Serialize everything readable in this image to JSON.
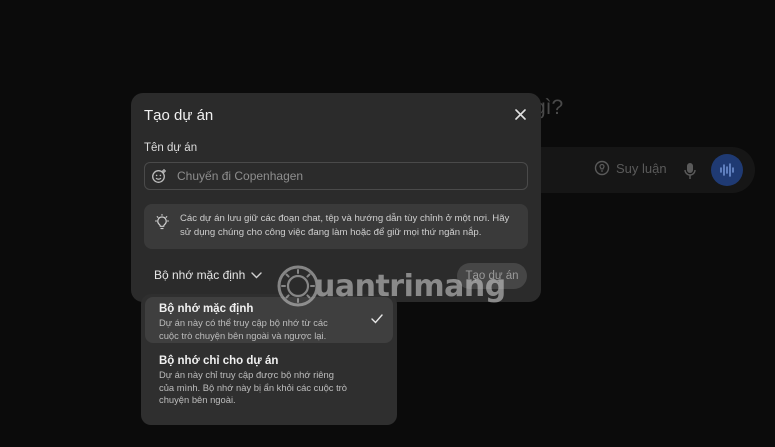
{
  "background": {
    "heading_fragment": "gì?",
    "reason_label": "Suy luận",
    "reason_icon": "bulb-circle-icon",
    "mic_icon": "mic-icon",
    "voice_icon": "waveform-icon",
    "voice_color": "#1f3a73"
  },
  "modal": {
    "title": "Tạo dự án",
    "close_icon": "close-icon",
    "name_label": "Tên dự án",
    "name_placeholder": "Chuyến đi Copenhagen",
    "name_value": "",
    "emoji_icon": "emoji-add-icon",
    "info_icon": "lightbulb-icon",
    "info_text": "Các dự án lưu giữ các đoạn chat, tệp và hướng dẫn tùy chỉnh ở một nơi. Hãy sử dụng chúng cho công việc đang làm hoặc để giữ mọi thứ ngăn nắp.",
    "memory_selected": "Bộ nhớ mặc định",
    "create_button": "Tạo dự án"
  },
  "memory_menu": {
    "items": [
      {
        "title": "Bộ nhớ mặc định",
        "description": "Dự án này có thể truy cập bộ nhớ từ các cuộc trò chuyện bên ngoài và ngược lại.",
        "selected": true
      },
      {
        "title": "Bộ nhớ chỉ cho dự án",
        "description": "Dự án này chỉ truy cập được bộ nhớ riêng của mình. Bộ nhớ này bị ẩn khỏi các cuộc trò chuyện bên ngoài.",
        "selected": false
      }
    ]
  },
  "watermark": {
    "text": "uantrimang"
  }
}
